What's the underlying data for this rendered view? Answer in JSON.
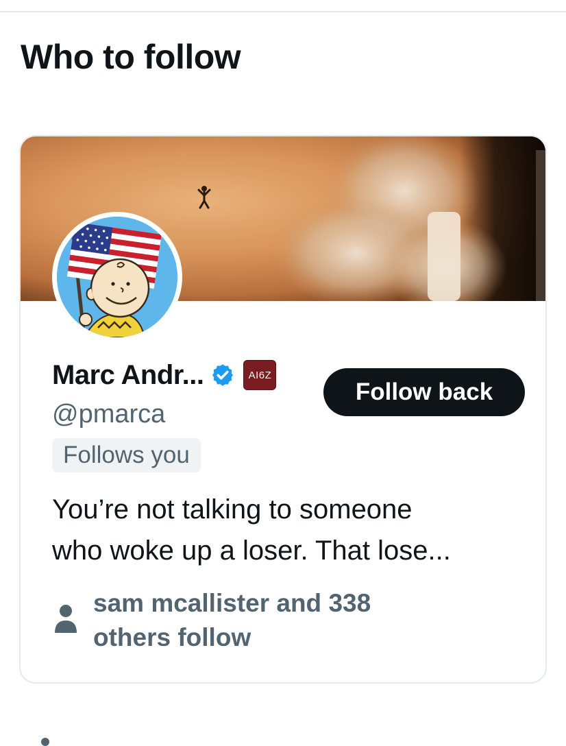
{
  "section": {
    "title": "Who to follow"
  },
  "card": {
    "display_name": "Marc Andr...",
    "affiliation_badge": "AI6Z",
    "handle": "@pmarca",
    "follows_you": "Follows you",
    "follow_button_label": "Follow back",
    "bio_line1": "You’re not talking to someone",
    "bio_line2": "who woke up a loser. That lose...",
    "followers_line1": "sam mcallister and 338",
    "followers_line2": "others follow"
  },
  "icons": {
    "verified": "verified-badge-icon",
    "person": "person-icon"
  },
  "colors": {
    "primary_text": "#0f1419",
    "secondary_text": "#536471",
    "verified_blue": "#1d9bf0",
    "button_bg": "#0f1419",
    "border": "#e7e9ea",
    "pill_bg": "#eff3f4",
    "affiliation_bg": "#7a1d22"
  }
}
